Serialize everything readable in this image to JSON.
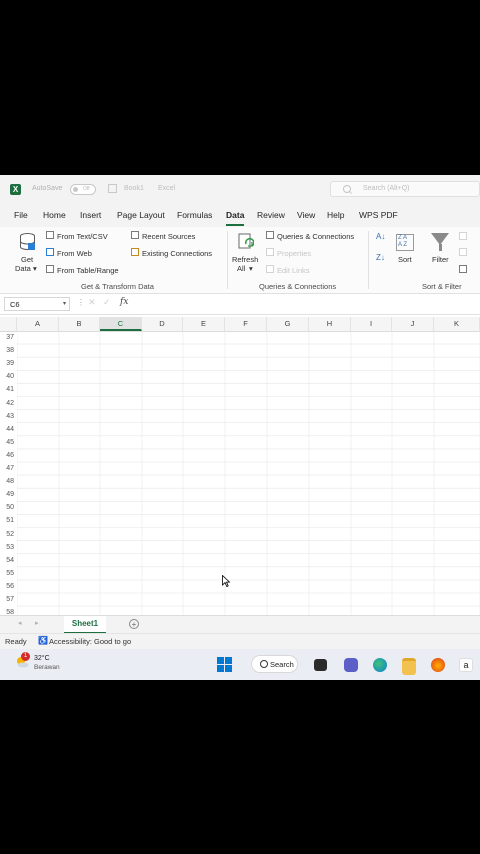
{
  "titlebar": {
    "autosave_label": "AutoSave",
    "autosave_state": "Off",
    "book_name": "Book1",
    "app_name": "Excel",
    "search_placeholder": "Search (Alt+Q)"
  },
  "tabs": [
    "File",
    "Home",
    "Insert",
    "Page Layout",
    "Formulas",
    "Data",
    "Review",
    "View",
    "Help",
    "WPS PDF"
  ],
  "active_tab": "Data",
  "ribbon": {
    "get_data": {
      "line1": "Get",
      "line2": "Data"
    },
    "from_text_csv": "From Text/CSV",
    "from_web": "From Web",
    "from_table_range": "From Table/Range",
    "recent_sources": "Recent Sources",
    "existing_connections": "Existing Connections",
    "group_get_transform": "Get & Transform Data",
    "refresh": {
      "line1": "Refresh",
      "line2": "All"
    },
    "queries_connections": "Queries & Connections",
    "properties": "Properties",
    "edit_links": "Edit Links",
    "group_queries": "Queries & Connections",
    "sort": "Sort",
    "filter": "Filter",
    "group_sort_filter": "Sort & Filter"
  },
  "formula_bar": {
    "name_box": "C6",
    "fx": "fx",
    "value": ""
  },
  "columns": [
    "A",
    "B",
    "C",
    "D",
    "E",
    "F",
    "G",
    "H",
    "I",
    "J",
    "K"
  ],
  "selected_column": "C",
  "rows": [
    "37",
    "38",
    "39",
    "40",
    "41",
    "42",
    "43",
    "44",
    "45",
    "46",
    "47",
    "48",
    "49",
    "50",
    "51",
    "52",
    "53",
    "54",
    "55",
    "56",
    "57",
    "58"
  ],
  "sheets": [
    "Sheet1"
  ],
  "status": {
    "ready": "Ready",
    "accessibility": "Accessibility: Good to go"
  },
  "taskbar": {
    "weather_temp": "32°C",
    "weather_place": "Berawan",
    "weather_badge": "1",
    "search_label": "Search"
  },
  "colors": {
    "excel_green": "#1d6f42",
    "windows_blue": "#0078d4"
  }
}
